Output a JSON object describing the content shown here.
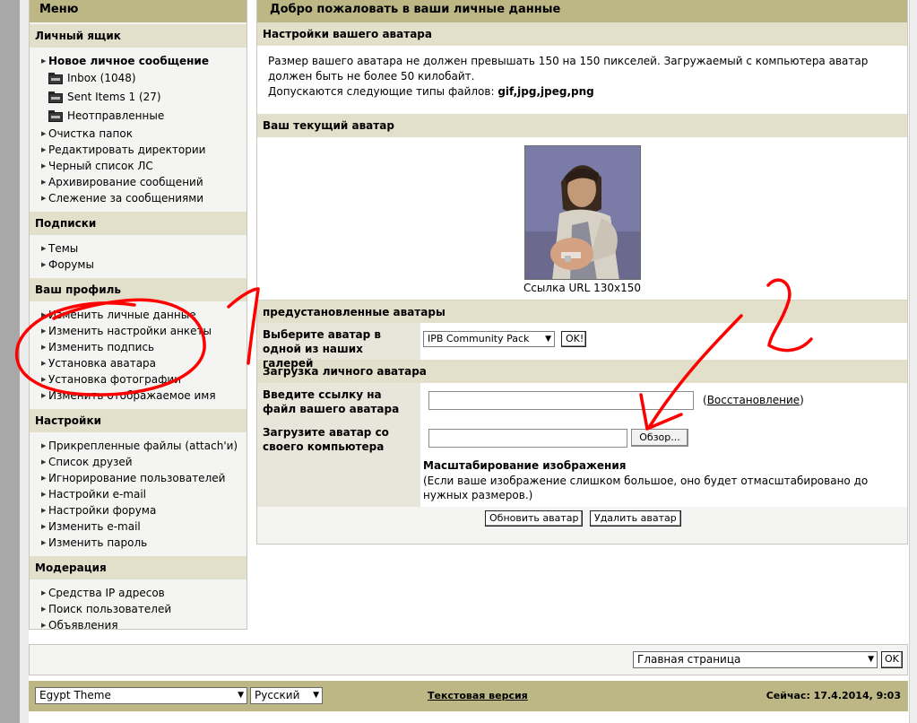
{
  "sidebar": {
    "title": "Меню",
    "sections": [
      {
        "header": "Личный ящик",
        "items": [
          {
            "label": "Новое личное сообщение",
            "bold": true
          },
          {
            "label": "Inbox (1048)",
            "icon": "folder"
          },
          {
            "label": "Sent Items 1 (27)",
            "icon": "folder"
          },
          {
            "label": "Неотправленные",
            "icon": "folder"
          },
          {
            "label": "Очистка папок"
          },
          {
            "label": "Редактировать директории"
          },
          {
            "label": "Черный список ЛС"
          },
          {
            "label": "Архивирование сообщений"
          },
          {
            "label": "Слежение за сообщениями"
          }
        ]
      },
      {
        "header": "Подписки",
        "items": [
          {
            "label": "Темы"
          },
          {
            "label": "Форумы"
          }
        ]
      },
      {
        "header": "Ваш профиль",
        "items": [
          {
            "label": "Изменить личные данные"
          },
          {
            "label": "Изменить настройки анкеты"
          },
          {
            "label": "Изменить подпись"
          },
          {
            "label": "Установка аватара"
          },
          {
            "label": "Установка фотографии"
          },
          {
            "label": "Изменить отображаемое имя"
          }
        ]
      },
      {
        "header": "Настройки",
        "items": [
          {
            "label": "Прикрепленные файлы (attach'и)"
          },
          {
            "label": "Список друзей"
          },
          {
            "label": "Игнорирование пользователей"
          },
          {
            "label": "Настройки e-mail"
          },
          {
            "label": "Настройки форума"
          },
          {
            "label": "Изменить e-mail"
          },
          {
            "label": "Изменить пароль"
          }
        ]
      },
      {
        "header": "Модерация",
        "items": [
          {
            "label": "Средства IP адресов"
          },
          {
            "label": "Поиск пользователей"
          },
          {
            "label": "Объявления"
          }
        ]
      }
    ]
  },
  "main": {
    "title": "Добро пожаловать в ваши личные данные",
    "settings_header": "Настройки вашего аватара",
    "info_line1": "Размер вашего аватара не должен превышать 150 на 150 пикселей. Загружаемый с компьютера аватар должен быть не более 50 килобайт.",
    "info_line2_prefix": "Допускаются следующие типы файлов:",
    "info_line2_types": "gif,jpg,jpeg,png",
    "current_header": "Ваш текущий аватар",
    "avatar_caption": "Ссылка URL 130x150",
    "preset_header": "предустановленные аватары",
    "gallery_label": "Выберите аватар в одной из наших галерей",
    "gallery_selected": "IPB Community Pack",
    "gallery_ok": "OK!",
    "upload_header": "Загрузка личного аватара",
    "url_label": "Введите ссылку на файл вашего аватара",
    "restore_link": "Восстановление",
    "restore_open": "(",
    "restore_close": ")",
    "file_label": "Загрузите аватар со своего компьютера",
    "browse_button": "Обзор...",
    "scale_title": "Масштабирование изображения",
    "scale_note": "(Если ваше изображение слишком большое, оно будет отмасштабировано до нужных размеров.)",
    "update_button": "Обновить аватар",
    "delete_button": "Удалить аватар"
  },
  "jump": {
    "selected": "Главная страница",
    "ok": "OK"
  },
  "footer": {
    "theme": "Egypt Theme",
    "language": "Русский",
    "text_version": "Текстовая версия",
    "now": "Сейчас: 17.4.2014, 9:03"
  },
  "annotations": {
    "number1": "1",
    "number2": "2",
    "color": "#ff0000"
  }
}
